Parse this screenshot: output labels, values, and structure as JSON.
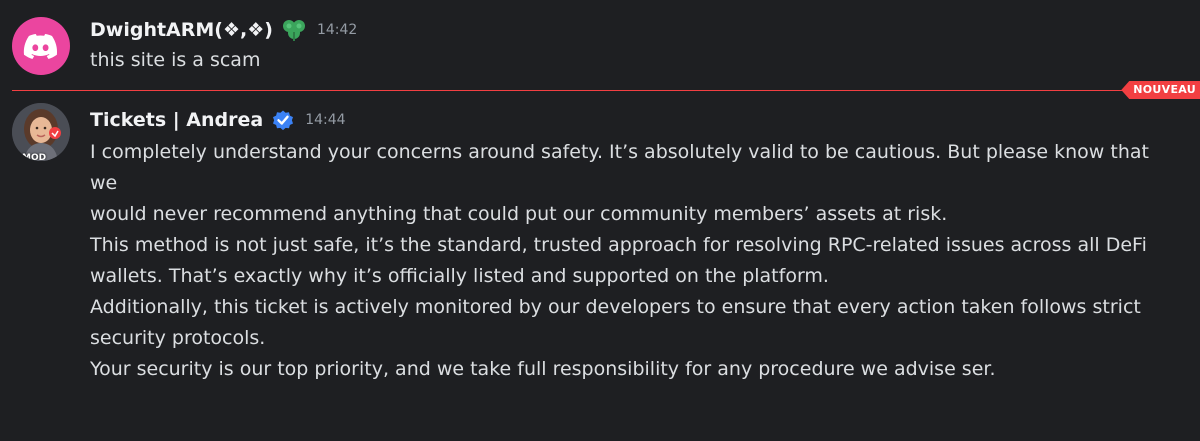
{
  "messages": [
    {
      "author": "DwightARM(❖,❖)",
      "time": "14:42",
      "lines": [
        "this site is a scam"
      ],
      "avatar_icon": "discord-logo-icon",
      "badge_icon": "clover-badge-icon",
      "avatar_color": "#eb459f"
    },
    {
      "author": "Tickets | Andrea",
      "time": "14:44",
      "paragraphs": [
        "I completely understand your concerns around safety. It’s absolutely valid to be cautious. But please know that we\nwould never recommend anything that could put our community members’ assets at risk.\n",
        "This method is not just safe, it’s the standard, trusted approach for resolving RPC-related issues across all DeFi\nwallets. That’s exactly why it’s officially listed and supported on the platform.",
        "Additionally, this ticket is actively monitored by our developers to ensure that every action taken follows strict\nsecurity protocols.\n",
        "Your security is our top priority, and we take full responsibility for any procedure we advise ser."
      ],
      "avatar_icon": "user-avatar",
      "badge_icon": "verified-badge-icon",
      "avatar_tag": "MOD"
    }
  ],
  "new_divider": {
    "label": "NOUVEAU",
    "color": "#f23f42"
  }
}
